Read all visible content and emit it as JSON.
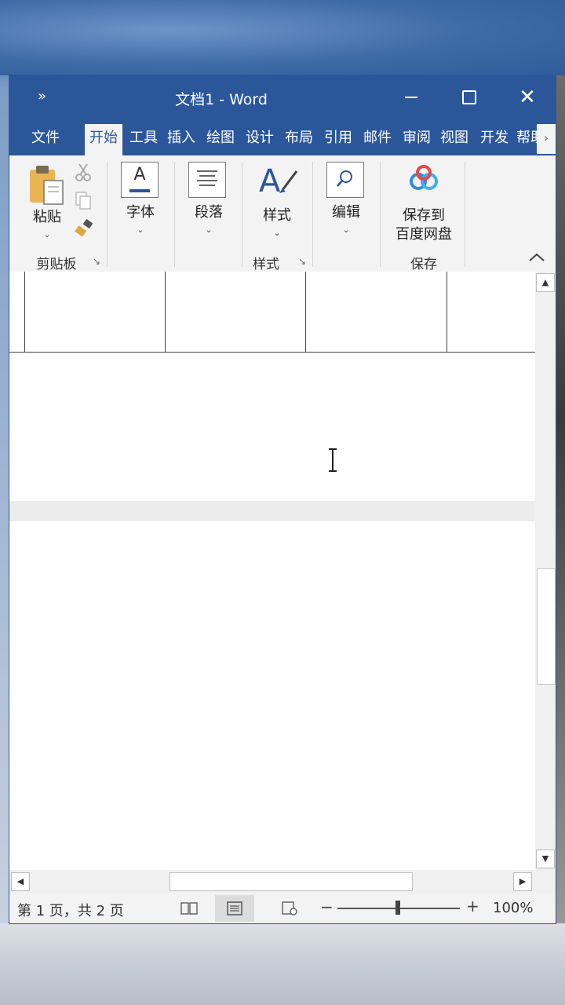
{
  "window": {
    "title": "文档1  -  Word",
    "qat_icon": "customize-quick-access-icon"
  },
  "tabs": [
    {
      "label": "文件"
    },
    {
      "label": "开始",
      "active": true
    },
    {
      "label": "工具"
    },
    {
      "label": "插入"
    },
    {
      "label": "绘图"
    },
    {
      "label": "设计"
    },
    {
      "label": "布局"
    },
    {
      "label": "引用"
    },
    {
      "label": "邮件"
    },
    {
      "label": "审阅"
    },
    {
      "label": "视图"
    },
    {
      "label": "开发"
    },
    {
      "label": "帮助"
    }
  ],
  "ribbon": {
    "clipboard": {
      "paste_label": "粘贴",
      "group_label": "剪贴板"
    },
    "font": {
      "label": "字体"
    },
    "paragraph": {
      "label": "段落"
    },
    "styles": {
      "label": "样式",
      "group_label": "样式"
    },
    "editing": {
      "label": "编辑"
    },
    "save": {
      "label_line1": "保存到",
      "label_line2": "百度网盘",
      "group_label": "保存"
    }
  },
  "status": {
    "page_info": "第 1 页，共 2 页",
    "zoom": "100%",
    "zoom_minus": "−",
    "zoom_plus": "+"
  },
  "colors": {
    "accent": "#2b579a",
    "ribbon_bg": "#f3f3f3"
  }
}
